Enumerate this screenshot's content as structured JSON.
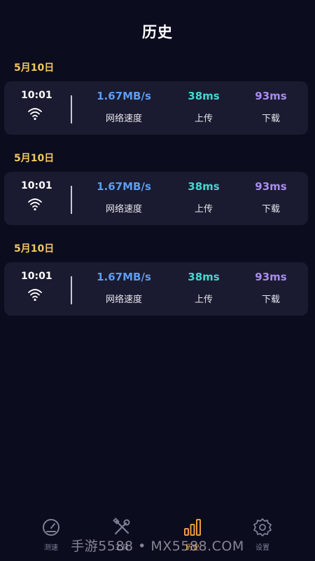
{
  "page": {
    "title": "历史"
  },
  "colors": {
    "background": "#0c0c1f",
    "card": "#1a1b30",
    "date": "#f2c860",
    "speed": "#5b9df2",
    "upload": "#43d6cf",
    "download": "#a98cf0",
    "tab_active": "#f09a40",
    "tab_inactive": "#7e7e95"
  },
  "history": [
    {
      "date": "5月10日",
      "time": "10:01",
      "icon": "wifi-icon",
      "speed": {
        "value": "1.67MB/s",
        "label": "网络速度"
      },
      "upload": {
        "value": "38ms",
        "label": "上传"
      },
      "download": {
        "value": "93ms",
        "label": "下载"
      }
    },
    {
      "date": "5月10日",
      "time": "10:01",
      "icon": "wifi-icon",
      "speed": {
        "value": "1.67MB/s",
        "label": "网络速度"
      },
      "upload": {
        "value": "38ms",
        "label": "上传"
      },
      "download": {
        "value": "93ms",
        "label": "下载"
      }
    },
    {
      "date": "5月10日",
      "time": "10:01",
      "icon": "wifi-icon",
      "speed": {
        "value": "1.67MB/s",
        "label": "网络速度"
      },
      "upload": {
        "value": "38ms",
        "label": "上传"
      },
      "download": {
        "value": "93ms",
        "label": "下载"
      }
    }
  ],
  "tabs": [
    {
      "label": "测速",
      "icon": "speedometer-icon",
      "active": false
    },
    {
      "label": "工具",
      "icon": "tools-icon",
      "active": false
    },
    {
      "label": "历史",
      "icon": "bar-chart-icon",
      "active": true
    },
    {
      "label": "设置",
      "icon": "gear-icon",
      "active": false
    }
  ],
  "watermark": "手游5588 • MX5588.COM"
}
